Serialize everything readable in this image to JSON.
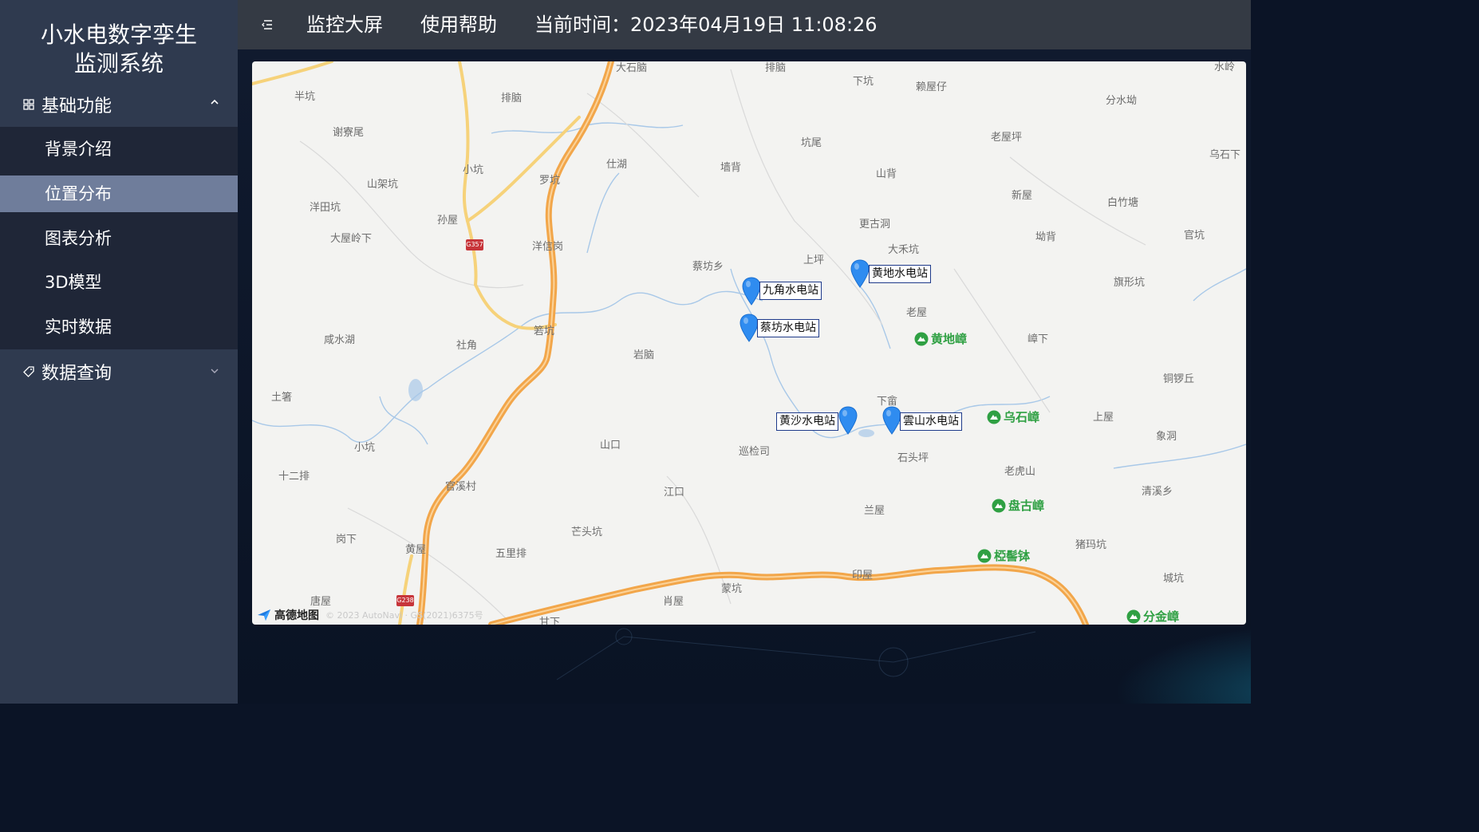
{
  "app": {
    "title_line1": "小水电数字孪生",
    "title_line2": "监测系统"
  },
  "sidebar": {
    "groups": [
      {
        "label": "基础功能",
        "icon": "grid-icon",
        "expanded": true
      },
      {
        "label": "数据查询",
        "icon": "tag-icon",
        "expanded": false
      }
    ],
    "items": [
      {
        "label": "背景介绍"
      },
      {
        "label": "位置分布",
        "active": true
      },
      {
        "label": "图表分析"
      },
      {
        "label": "3D模型"
      },
      {
        "label": "实时数据"
      }
    ]
  },
  "topbar": {
    "menu_icon": "menu-fold-icon",
    "nav1": "监控大屏",
    "nav2": "使用帮助",
    "time_label": "当前时间：",
    "time_value": "2023年04月19日 11:08:26"
  },
  "map": {
    "stations": [
      {
        "name": "九角水电站"
      },
      {
        "name": "黄地水电站"
      },
      {
        "name": "蔡坊水电站"
      },
      {
        "name": "黄沙水电站"
      },
      {
        "name": "雲山水电站"
      }
    ],
    "pois": [
      "黄地嶂",
      "乌石嶂",
      "盘古嶂",
      "椏髻钵",
      "分金嶂"
    ],
    "places": [
      "大石脑",
      "排脑",
      "下坑",
      "赖屋仔",
      "分水坳",
      "水岭",
      "半坑",
      "排脑",
      "谢寮尾",
      "坑尾",
      "老屋坪",
      "乌石下",
      "小坑",
      "仕湖",
      "罗坑",
      "墙背",
      "山背",
      "新屋",
      "白竹塘",
      "山架坑",
      "洋田坑",
      "孙屋",
      "更古洞",
      "坳背",
      "官坑",
      "大屋岭下",
      "洋信岗",
      "上坪",
      "大禾坑",
      "旗形坑",
      "蔡坊乡",
      "老屋",
      "咸水湖",
      "社角",
      "箬坑",
      "岩脑",
      "嶂下",
      "铜锣丘",
      "土箸",
      "下畲",
      "上屋",
      "象洞",
      "小坑",
      "山口",
      "巡检司",
      "石头坪",
      "老虎山",
      "十二排",
      "官溪村",
      "江口",
      "兰屋",
      "清溪乡",
      "岗下",
      "芒头坑",
      "猪玛坑",
      "黄屋",
      "五里排",
      "印屋",
      "唐屋",
      "肖屋",
      "蒙坑",
      "城坑",
      "甘下"
    ],
    "road_shields": [
      "G357",
      "G238"
    ],
    "attribution": "高德地图",
    "copyright": "© 2023 AutoNavi · GS(2021)6375号"
  },
  "colors": {
    "sidebar_bg": "#2f3a4f",
    "submenu_bg": "#1f2637",
    "active_item_bg": "#6f7d9b",
    "topbar_bg": "#343a44",
    "main_bg": "#0b1426",
    "marker_blue": "#2f8cf0",
    "poi_green": "#2fa043",
    "highway_orange": "#f2a64a"
  }
}
